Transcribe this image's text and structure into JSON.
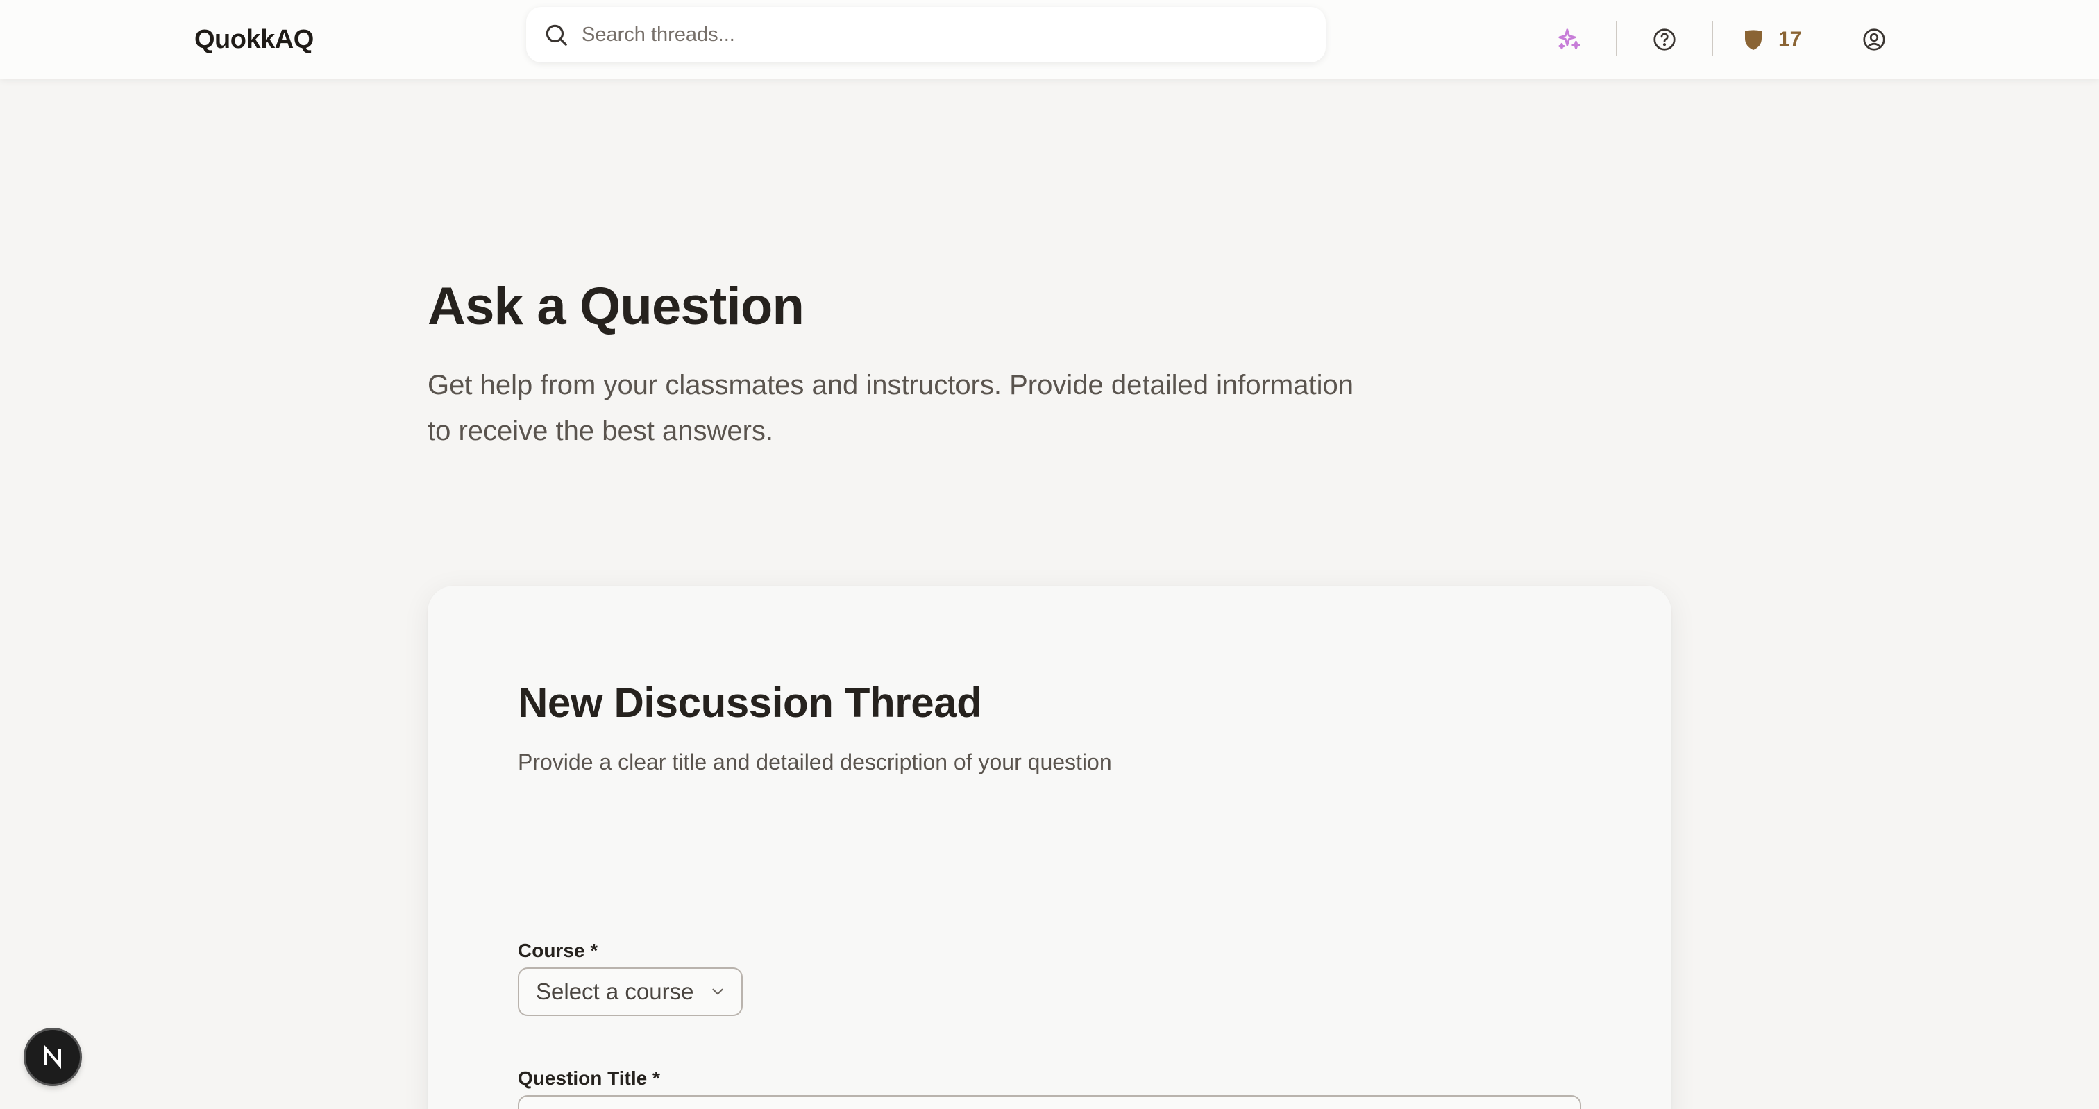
{
  "app": {
    "brand": "QuokkAQ"
  },
  "search": {
    "placeholder": "Search threads..."
  },
  "header": {
    "points": "17",
    "icons": [
      "sparkles-icon",
      "help-circle-icon",
      "shield-icon",
      "user-circle-icon"
    ],
    "colors": {
      "sparkles": "#c77dd8",
      "shield": "#8a6434"
    }
  },
  "hero": {
    "title": "Ask a Question",
    "subtitle_line1": "Get help from your classmates and instructors. Provide detailed information",
    "subtitle_line2": "to receive the best answers."
  },
  "form": {
    "title": "New Discussion Thread",
    "subtitle": "Provide a clear title and detailed description of your question",
    "course_label": "Course *",
    "course_select": "Select a course",
    "question_title_label": "Question Title *",
    "question_title_value": ""
  },
  "badge": {
    "letter": "N"
  }
}
